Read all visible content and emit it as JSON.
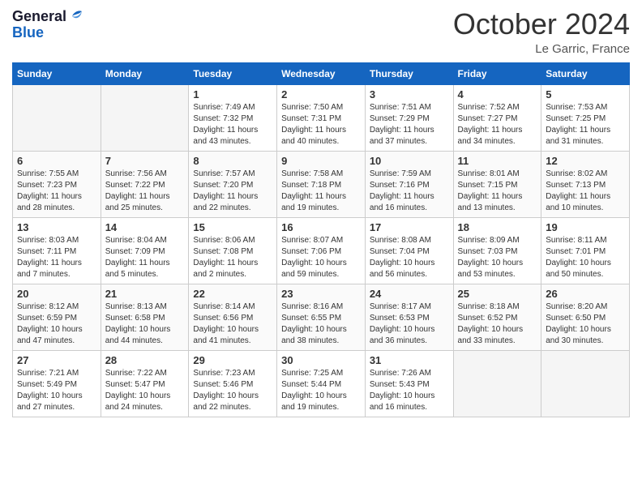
{
  "header": {
    "logo_line1": "General",
    "logo_line2": "Blue",
    "month_title": "October 2024",
    "location": "Le Garric, France"
  },
  "weekdays": [
    "Sunday",
    "Monday",
    "Tuesday",
    "Wednesday",
    "Thursday",
    "Friday",
    "Saturday"
  ],
  "weeks": [
    [
      {
        "day": "",
        "sunrise": "",
        "sunset": "",
        "daylight": "",
        "empty": true
      },
      {
        "day": "",
        "sunrise": "",
        "sunset": "",
        "daylight": "",
        "empty": true
      },
      {
        "day": "1",
        "sunrise": "Sunrise: 7:49 AM",
        "sunset": "Sunset: 7:32 PM",
        "daylight": "Daylight: 11 hours and 43 minutes.",
        "empty": false
      },
      {
        "day": "2",
        "sunrise": "Sunrise: 7:50 AM",
        "sunset": "Sunset: 7:31 PM",
        "daylight": "Daylight: 11 hours and 40 minutes.",
        "empty": false
      },
      {
        "day": "3",
        "sunrise": "Sunrise: 7:51 AM",
        "sunset": "Sunset: 7:29 PM",
        "daylight": "Daylight: 11 hours and 37 minutes.",
        "empty": false
      },
      {
        "day": "4",
        "sunrise": "Sunrise: 7:52 AM",
        "sunset": "Sunset: 7:27 PM",
        "daylight": "Daylight: 11 hours and 34 minutes.",
        "empty": false
      },
      {
        "day": "5",
        "sunrise": "Sunrise: 7:53 AM",
        "sunset": "Sunset: 7:25 PM",
        "daylight": "Daylight: 11 hours and 31 minutes.",
        "empty": false
      }
    ],
    [
      {
        "day": "6",
        "sunrise": "Sunrise: 7:55 AM",
        "sunset": "Sunset: 7:23 PM",
        "daylight": "Daylight: 11 hours and 28 minutes.",
        "empty": false
      },
      {
        "day": "7",
        "sunrise": "Sunrise: 7:56 AM",
        "sunset": "Sunset: 7:22 PM",
        "daylight": "Daylight: 11 hours and 25 minutes.",
        "empty": false
      },
      {
        "day": "8",
        "sunrise": "Sunrise: 7:57 AM",
        "sunset": "Sunset: 7:20 PM",
        "daylight": "Daylight: 11 hours and 22 minutes.",
        "empty": false
      },
      {
        "day": "9",
        "sunrise": "Sunrise: 7:58 AM",
        "sunset": "Sunset: 7:18 PM",
        "daylight": "Daylight: 11 hours and 19 minutes.",
        "empty": false
      },
      {
        "day": "10",
        "sunrise": "Sunrise: 7:59 AM",
        "sunset": "Sunset: 7:16 PM",
        "daylight": "Daylight: 11 hours and 16 minutes.",
        "empty": false
      },
      {
        "day": "11",
        "sunrise": "Sunrise: 8:01 AM",
        "sunset": "Sunset: 7:15 PM",
        "daylight": "Daylight: 11 hours and 13 minutes.",
        "empty": false
      },
      {
        "day": "12",
        "sunrise": "Sunrise: 8:02 AM",
        "sunset": "Sunset: 7:13 PM",
        "daylight": "Daylight: 11 hours and 10 minutes.",
        "empty": false
      }
    ],
    [
      {
        "day": "13",
        "sunrise": "Sunrise: 8:03 AM",
        "sunset": "Sunset: 7:11 PM",
        "daylight": "Daylight: 11 hours and 7 minutes.",
        "empty": false
      },
      {
        "day": "14",
        "sunrise": "Sunrise: 8:04 AM",
        "sunset": "Sunset: 7:09 PM",
        "daylight": "Daylight: 11 hours and 5 minutes.",
        "empty": false
      },
      {
        "day": "15",
        "sunrise": "Sunrise: 8:06 AM",
        "sunset": "Sunset: 7:08 PM",
        "daylight": "Daylight: 11 hours and 2 minutes.",
        "empty": false
      },
      {
        "day": "16",
        "sunrise": "Sunrise: 8:07 AM",
        "sunset": "Sunset: 7:06 PM",
        "daylight": "Daylight: 10 hours and 59 minutes.",
        "empty": false
      },
      {
        "day": "17",
        "sunrise": "Sunrise: 8:08 AM",
        "sunset": "Sunset: 7:04 PM",
        "daylight": "Daylight: 10 hours and 56 minutes.",
        "empty": false
      },
      {
        "day": "18",
        "sunrise": "Sunrise: 8:09 AM",
        "sunset": "Sunset: 7:03 PM",
        "daylight": "Daylight: 10 hours and 53 minutes.",
        "empty": false
      },
      {
        "day": "19",
        "sunrise": "Sunrise: 8:11 AM",
        "sunset": "Sunset: 7:01 PM",
        "daylight": "Daylight: 10 hours and 50 minutes.",
        "empty": false
      }
    ],
    [
      {
        "day": "20",
        "sunrise": "Sunrise: 8:12 AM",
        "sunset": "Sunset: 6:59 PM",
        "daylight": "Daylight: 10 hours and 47 minutes.",
        "empty": false
      },
      {
        "day": "21",
        "sunrise": "Sunrise: 8:13 AM",
        "sunset": "Sunset: 6:58 PM",
        "daylight": "Daylight: 10 hours and 44 minutes.",
        "empty": false
      },
      {
        "day": "22",
        "sunrise": "Sunrise: 8:14 AM",
        "sunset": "Sunset: 6:56 PM",
        "daylight": "Daylight: 10 hours and 41 minutes.",
        "empty": false
      },
      {
        "day": "23",
        "sunrise": "Sunrise: 8:16 AM",
        "sunset": "Sunset: 6:55 PM",
        "daylight": "Daylight: 10 hours and 38 minutes.",
        "empty": false
      },
      {
        "day": "24",
        "sunrise": "Sunrise: 8:17 AM",
        "sunset": "Sunset: 6:53 PM",
        "daylight": "Daylight: 10 hours and 36 minutes.",
        "empty": false
      },
      {
        "day": "25",
        "sunrise": "Sunrise: 8:18 AM",
        "sunset": "Sunset: 6:52 PM",
        "daylight": "Daylight: 10 hours and 33 minutes.",
        "empty": false
      },
      {
        "day": "26",
        "sunrise": "Sunrise: 8:20 AM",
        "sunset": "Sunset: 6:50 PM",
        "daylight": "Daylight: 10 hours and 30 minutes.",
        "empty": false
      }
    ],
    [
      {
        "day": "27",
        "sunrise": "Sunrise: 7:21 AM",
        "sunset": "Sunset: 5:49 PM",
        "daylight": "Daylight: 10 hours and 27 minutes.",
        "empty": false
      },
      {
        "day": "28",
        "sunrise": "Sunrise: 7:22 AM",
        "sunset": "Sunset: 5:47 PM",
        "daylight": "Daylight: 10 hours and 24 minutes.",
        "empty": false
      },
      {
        "day": "29",
        "sunrise": "Sunrise: 7:23 AM",
        "sunset": "Sunset: 5:46 PM",
        "daylight": "Daylight: 10 hours and 22 minutes.",
        "empty": false
      },
      {
        "day": "30",
        "sunrise": "Sunrise: 7:25 AM",
        "sunset": "Sunset: 5:44 PM",
        "daylight": "Daylight: 10 hours and 19 minutes.",
        "empty": false
      },
      {
        "day": "31",
        "sunrise": "Sunrise: 7:26 AM",
        "sunset": "Sunset: 5:43 PM",
        "daylight": "Daylight: 10 hours and 16 minutes.",
        "empty": false
      },
      {
        "day": "",
        "sunrise": "",
        "sunset": "",
        "daylight": "",
        "empty": true
      },
      {
        "day": "",
        "sunrise": "",
        "sunset": "",
        "daylight": "",
        "empty": true
      }
    ]
  ]
}
